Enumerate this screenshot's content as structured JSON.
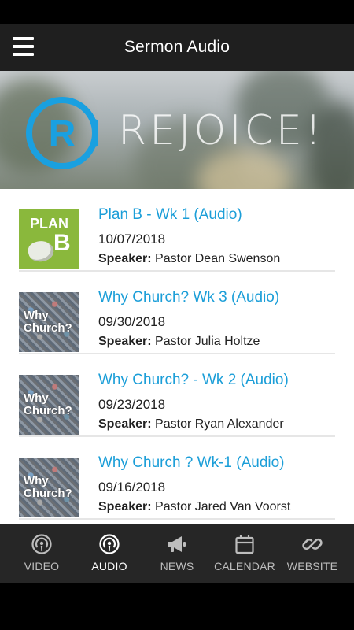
{
  "header": {
    "title": "Sermon Audio"
  },
  "banner": {
    "logo_letter": "R",
    "text": "REJOICE!"
  },
  "sermons": [
    {
      "thumb": "plan-b",
      "title": "Plan B - Wk 1 (Audio)",
      "date": "10/07/2018",
      "speaker_label": "Speaker:",
      "speaker": "Pastor Dean Swenson"
    },
    {
      "thumb": "why-church",
      "title": "Why Church? Wk 3 (Audio)",
      "date": "09/30/2018",
      "speaker_label": "Speaker:",
      "speaker": "Pastor Julia Holtze"
    },
    {
      "thumb": "why-church",
      "title": "Why Church? - Wk 2 (Audio)",
      "date": "09/23/2018",
      "speaker_label": "Speaker:",
      "speaker": "Pastor Ryan Alexander"
    },
    {
      "thumb": "why-church",
      "title": "Why Church ? Wk-1 (Audio)",
      "date": "09/16/2018",
      "speaker_label": "Speaker:",
      "speaker": "Pastor Jared Van Voorst"
    }
  ],
  "thumbs": {
    "plan_b": {
      "line1": "PLAN",
      "line2": "B"
    },
    "why_church": {
      "line1": "Why",
      "line2": "Church?"
    }
  },
  "tabs": [
    {
      "label": "VIDEO",
      "icon": "podcast-icon",
      "active": false
    },
    {
      "label": "AUDIO",
      "icon": "podcast-icon",
      "active": true
    },
    {
      "label": "NEWS",
      "icon": "megaphone-icon",
      "active": false
    },
    {
      "label": "CALENDAR",
      "icon": "calendar-icon",
      "active": false
    },
    {
      "label": "WEBSITE",
      "icon": "link-icon",
      "active": false
    }
  ],
  "colors": {
    "accent": "#1b9ed8",
    "header_bg": "#1f1f1f",
    "tabbar_bg": "#262626",
    "planb_green": "#8ab83c"
  }
}
